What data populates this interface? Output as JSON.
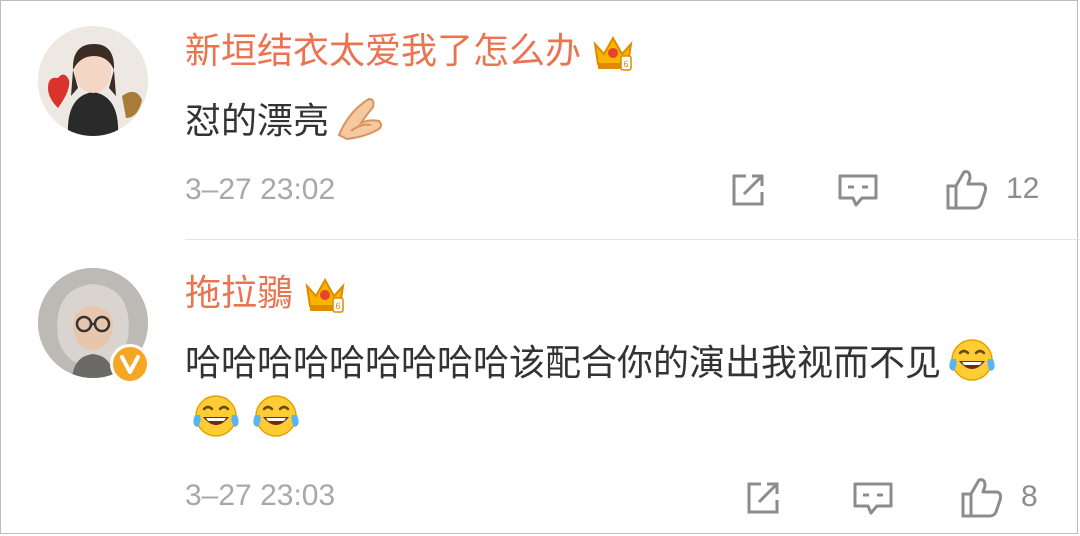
{
  "comments": [
    {
      "username": "新垣结衣太爱我了怎么办",
      "text": "怼的漂亮",
      "emoji": [
        "praying-hands-emoji"
      ],
      "timestamp": "3–27 23:02",
      "likes": "12",
      "badge": "crown-vip-badge"
    },
    {
      "username": "拖拉鶸",
      "text": "哈哈哈哈哈哈哈哈哈该配合你的演出我视而不见",
      "emoji": [
        "tears-of-joy-emoji",
        "tears-of-joy-emoji",
        "tears-of-joy-emoji"
      ],
      "timestamp": "3–27 23:03",
      "likes": "8",
      "badge": "crown-vip-badge",
      "verified": true
    }
  ],
  "colors": {
    "username": "#eb7350",
    "text": "#333333",
    "timestamp": "#a8a8a8",
    "icon": "#8c8c8c",
    "verified": "#f5a623"
  }
}
